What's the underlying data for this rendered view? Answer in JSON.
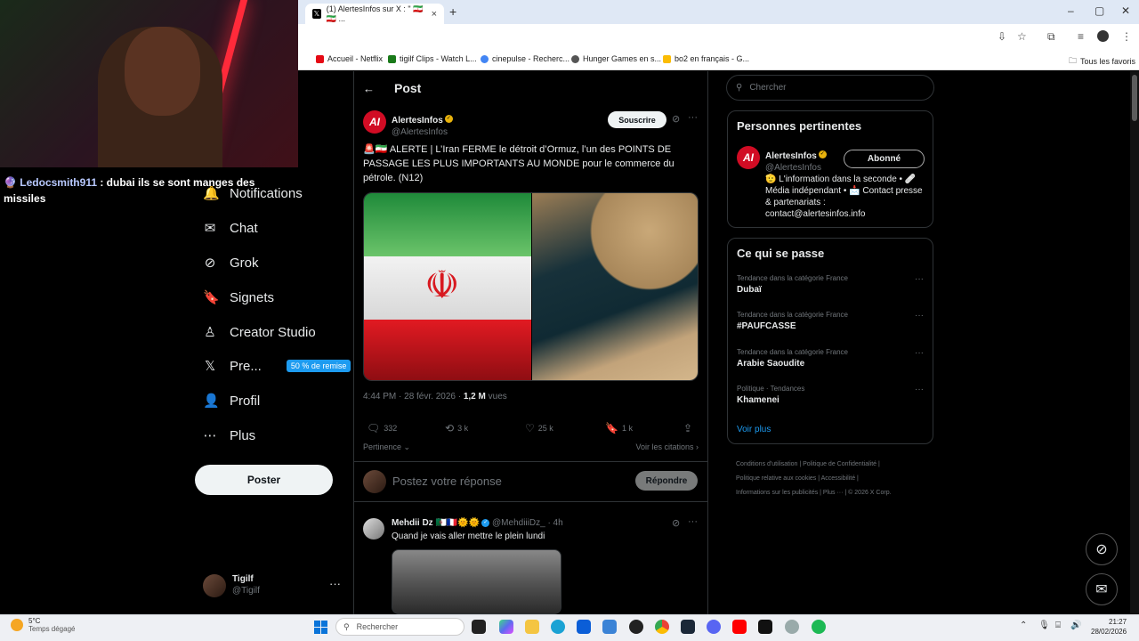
{
  "browser": {
    "tab_title": "(1) AlertesInfos sur X : \" 🇮🇷 🇮🇷 ...",
    "bookmarks": [
      "Accueil - Netflix",
      "tigilf Clips - Watch L...",
      "cinepulse - Recherc...",
      "Hunger Games en s...",
      "bo2 en français - G..."
    ],
    "all_bookmarks": "Tous les favoris"
  },
  "stream_chat": {
    "user": "Ledocsmith911",
    "message": ": dubai ils se sont manges des missiles"
  },
  "nav": {
    "items": [
      {
        "label": "Notifications",
        "icon": "🔔"
      },
      {
        "label": "Chat",
        "icon": "✉"
      },
      {
        "label": "Grok",
        "icon": "⊘"
      },
      {
        "label": "Signets",
        "icon": "🔖"
      },
      {
        "label": "Creator Studio",
        "icon": "♙"
      },
      {
        "label": "Pre...",
        "icon": "𝕏"
      },
      {
        "label": "Profil",
        "icon": "👤"
      },
      {
        "label": "Plus",
        "icon": "⋯"
      }
    ],
    "promo_badge": "50 % de remise",
    "post_button": "Poster",
    "account_name": "Tigilf",
    "account_handle": "@Tigilf"
  },
  "post": {
    "header": "Post",
    "author_name": "AlertesInfos",
    "author_handle": "@AlertesInfos",
    "subscribe": "Souscrire",
    "text": "🚨🇮🇷 ALERTE | L’Iran FERME le détroit d’Ormuz, l’un des POINTS DE PASSAGE LES PLUS IMPORTANTS AU MONDE pour le commerce du pétrole. (N12)",
    "timestamp": "4:44 PM · 28 févr. 2026 · ",
    "views_count": "1,2 M",
    "views_label": " vues",
    "replies": "332",
    "reposts": "3 k",
    "likes": "25 k",
    "bookmarks": "1 k",
    "sort": "Pertinence",
    "quotes_link": "Voir les citations",
    "reply_placeholder": "Postez votre réponse",
    "reply_button": "Répondre"
  },
  "comment": {
    "name": "Mehdii Dz 🇩🇿🇫🇷🌞🌞",
    "handle": "@MehdiiiDz_",
    "time": "· 4h",
    "text": "Quand je vais aller mettre le plein lundi"
  },
  "sidebar": {
    "search_placeholder": "Chercher",
    "relevant_title": "Personnes pertinentes",
    "relevant_name": "AlertesInfos",
    "relevant_handle": "@AlertesInfos",
    "follow_label": "Abonné",
    "bio": "🫡 L'information dans la seconde • 🩹 Média indépendant • 📩 Contact presse & partenariats : contact@alertesinfos.info",
    "trends_title": "Ce qui se passe",
    "trends": [
      {
        "category": "Tendance dans la catégorie France",
        "topic": "Dubaï"
      },
      {
        "category": "Tendance dans la catégorie France",
        "topic": "#PAUFCASSE"
      },
      {
        "category": "Tendance dans la catégorie France",
        "topic": "Arabie Saoudite"
      },
      {
        "category": "Politique · Tendances",
        "topic": "Khamenei"
      }
    ],
    "see_more": "Voir plus",
    "footer_line1": "Conditions d'utilisation  |  Politique de Confidentialité  |",
    "footer_line2": "Politique relative aux cookies  |  Accessibilité  |",
    "footer_line3": "Informations sur les publicités  |  Plus ···  |  © 2026 X Corp."
  },
  "taskbar": {
    "temperature": "5°C",
    "weather": "Temps dégagé",
    "search": "Rechercher",
    "time": "21:27",
    "date": "28/02/2026"
  }
}
